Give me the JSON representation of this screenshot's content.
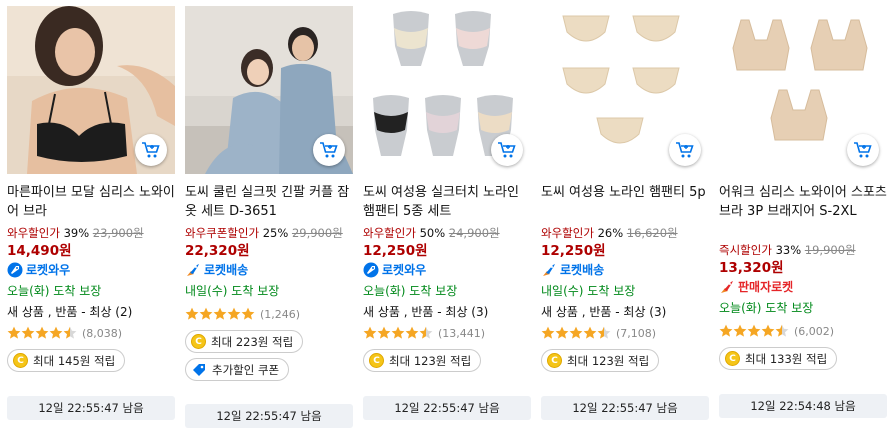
{
  "colors": {
    "price_red": "#ae0000",
    "rocket_blue": "#0073e9",
    "seller_red": "#e52528",
    "arrival_green": "#00891a",
    "star": "#f5a623"
  },
  "products": [
    {
      "name": "마른파이브 모달 심리스 노와이어 브라",
      "discount_label": "와우할인가",
      "discount_pct": "39%",
      "original_price": "23,900원",
      "price": "14,490원",
      "badge": "로켓와우",
      "badge_icon": "rocket-wow-icon",
      "arrival": "오늘(화) 도착 보장",
      "condition": "새 상품 , 반품 - 최상 (2)",
      "rating": 4.5,
      "review_count": "(8,038)",
      "coupons": [
        {
          "icon": "coin-icon",
          "text": "최대 145원 적립"
        }
      ],
      "timer": "12일 22:55:47 남음"
    },
    {
      "name": "도씨 쿨린 실크핏 긴팔 커플 잠옷 세트 D-3651",
      "discount_label": "와우쿠폰할인가",
      "discount_pct": "25%",
      "original_price": "29,900원",
      "price": "22,320원",
      "badge": "로켓배송",
      "badge_icon": "rocket-icon",
      "arrival": "내일(수) 도착 보장",
      "condition": "",
      "rating": 5,
      "review_count": "(1,246)",
      "coupons": [
        {
          "icon": "coin-icon",
          "text": "최대 223원 적립"
        },
        {
          "icon": "tag-icon",
          "text": "추가할인 쿠폰"
        }
      ],
      "timer": "12일 22:55:47 남음"
    },
    {
      "name": "도씨 여성용 실크터치 노라인 햄팬티 5종 세트",
      "discount_label": "와우할인가",
      "discount_pct": "50%",
      "original_price": "24,900원",
      "price": "12,250원",
      "badge": "로켓와우",
      "badge_icon": "rocket-wow-icon",
      "arrival": "오늘(화) 도착 보장",
      "condition": "새 상품 , 반품 - 최상 (3)",
      "rating": 4.5,
      "review_count": "(13,441)",
      "coupons": [
        {
          "icon": "coin-icon",
          "text": "최대 123원 적립"
        }
      ],
      "timer": "12일 22:55:47 남음"
    },
    {
      "name": "도씨 여성용 노라인 햄팬티 5p",
      "discount_label": "와우할인가",
      "discount_pct": "26%",
      "original_price": "16,620원",
      "price": "12,250원",
      "badge": "로켓배송",
      "badge_icon": "rocket-icon",
      "arrival": "내일(수) 도착 보장",
      "condition": "새 상품 , 반품 - 최상 (3)",
      "rating": 4.5,
      "review_count": "(7,108)",
      "coupons": [
        {
          "icon": "coin-icon",
          "text": "최대 123원 적립"
        }
      ],
      "timer": "12일 22:55:47 남음"
    },
    {
      "name": "어워크 심리스 노와이어 스포츠 브라 3P 브래지어 S-2XL",
      "discount_label": "즉시할인가",
      "discount_pct": "33%",
      "original_price": "19,900원",
      "price": "13,320원",
      "badge": "판매자로켓",
      "badge_icon": "seller-rocket-icon",
      "arrival": "오늘(화) 도착 보장",
      "condition": "",
      "rating": 4.5,
      "review_count": "(6,002)",
      "coupons": [
        {
          "icon": "coin-icon",
          "text": "최대 133원 적립"
        }
      ],
      "timer": "12일 22:54:48 남음"
    }
  ]
}
